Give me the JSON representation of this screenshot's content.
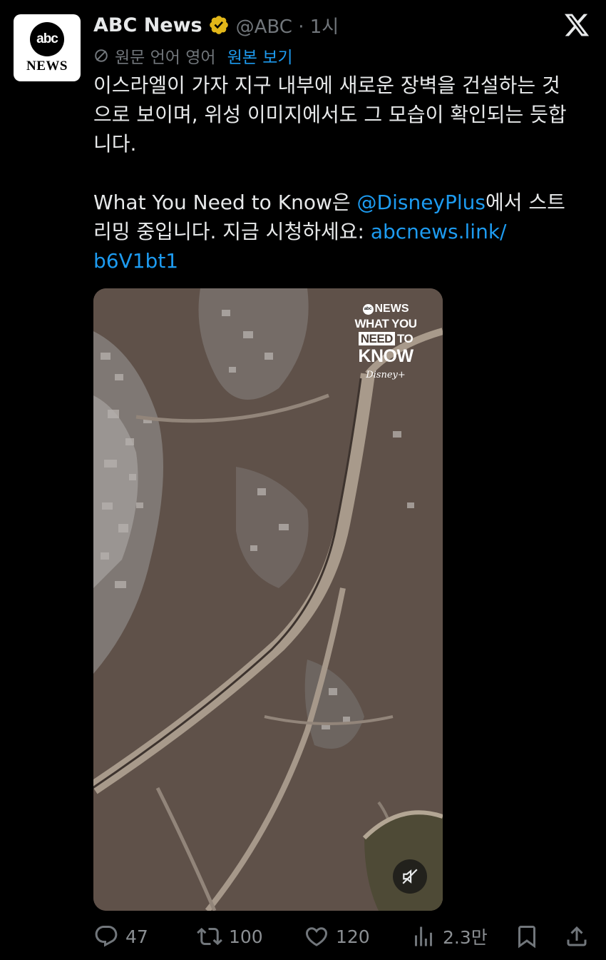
{
  "author": {
    "avatar_line1": "abc",
    "avatar_line2": "NEWS",
    "display_name": "ABC News",
    "handle_time": "@ABC · 1시"
  },
  "translation": {
    "source_label": "원문 언어 영어",
    "show_original": "원본 보기"
  },
  "tweet": {
    "line1": "이스라엘이 가자 지구 내부에 새로운 장벽을 건설하는 것",
    "line2": "으로 보이며, 위성 이미지에서도 그 모습이 확인되는 듯합",
    "line3": "니다.",
    "p2_text_a": "What You Need to Know은 ",
    "mention": "@DisneyPlus",
    "p2_text_b": "에서 스트",
    "p2_line2_text": "리밍 중입니다. 지금 시청하세요: ",
    "link_part1": "abcnews.link/",
    "link_part2": "b6V1bt1"
  },
  "media_branding": {
    "news": "NEWS",
    "line1": "WHAT YOU",
    "line2_box": "NEED",
    "line2_rest": "TO",
    "line3": "KNOW",
    "disney": "Disney+"
  },
  "actions": {
    "replies": "47",
    "reposts": "100",
    "likes": "120",
    "views": "2.3만"
  },
  "icons": [
    "verified-badge-icon",
    "x-logo-icon",
    "translate-icon",
    "mute-icon",
    "reply-icon",
    "repost-icon",
    "like-icon",
    "views-icon",
    "bookmark-icon",
    "share-icon"
  ],
  "colors": {
    "background": "#000000",
    "text": "#e7e9ea",
    "muted": "#71767b",
    "link": "#1d9bf0",
    "verified": "#e2b719"
  }
}
